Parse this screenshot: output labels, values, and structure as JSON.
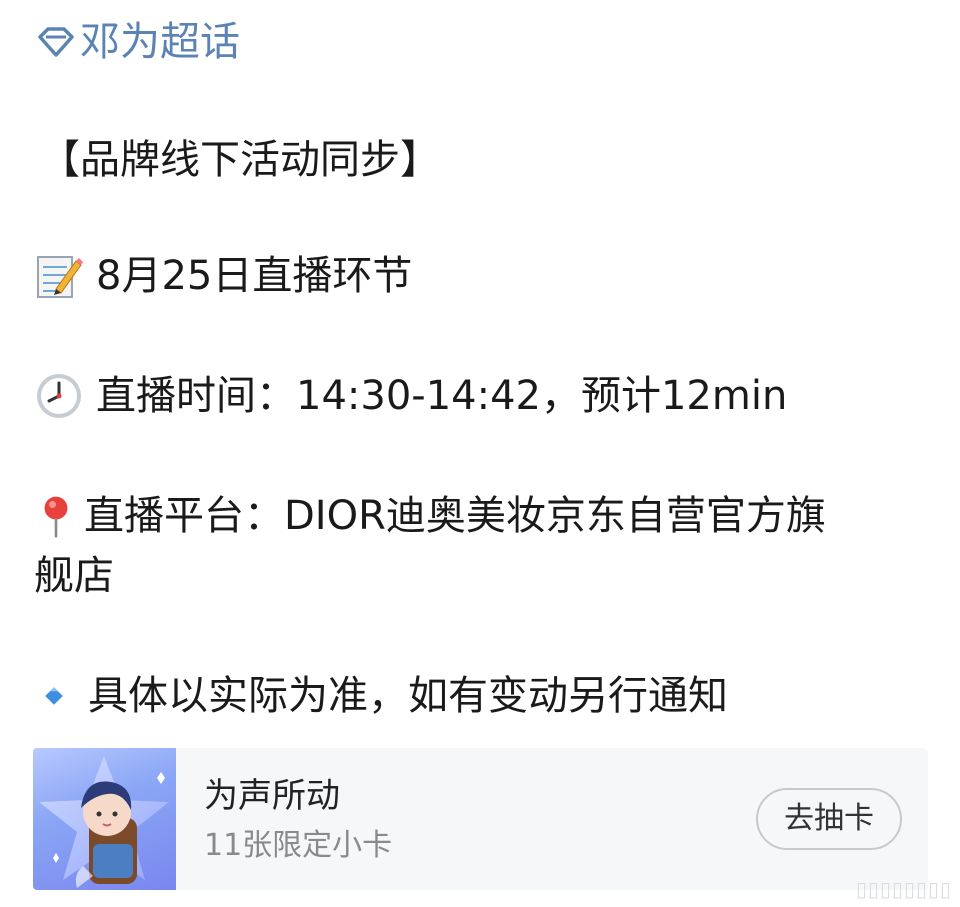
{
  "post": {
    "topic": "邓为超话",
    "title": "【品牌线下活动同步】",
    "live_section": "8月25日直播环节",
    "live_time": "直播时间：14:30-14:42，预计12min",
    "platform_line1": "直播平台：DIOR迪奥美妆京东自营官方旗",
    "platform_line2": "舰店",
    "note": "具体以实际为准，如有变动另行通知"
  },
  "card": {
    "title": "为声所动",
    "subtitle": "11张限定小卡",
    "button_label": "去抽卡"
  },
  "icons": {
    "topic": "diamond-icon",
    "memo": "memo-emoji-icon",
    "clock": "clock-emoji-icon",
    "pin": "pushpin-emoji-icon",
    "diamond": "small-blue-diamond-icon"
  },
  "colors": {
    "topic": "#5b84b5",
    "text": "#1a1a1a",
    "card_bg": "#f6f7f9",
    "subtitle": "#8a8a8a"
  }
}
